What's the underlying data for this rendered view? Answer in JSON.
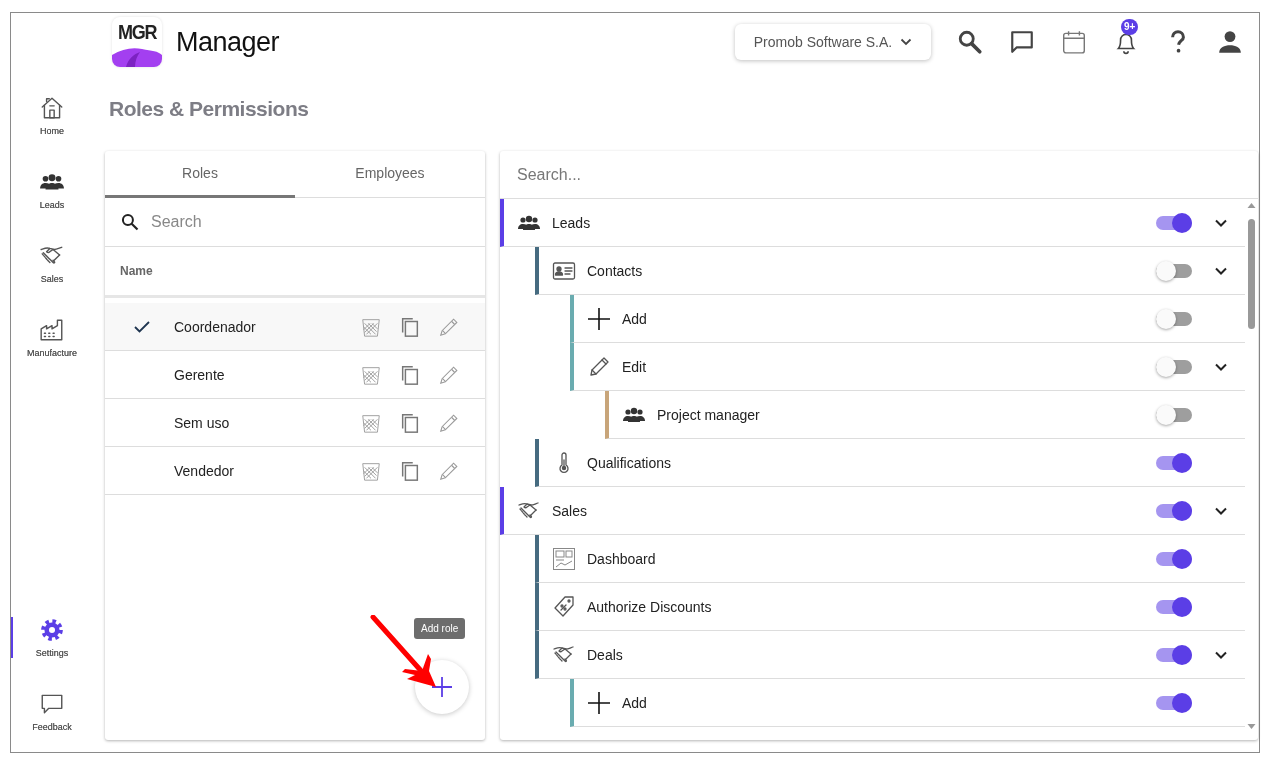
{
  "nav": {
    "top": [
      {
        "kind": "home",
        "label": "Home",
        "selected": false
      },
      {
        "kind": "leads",
        "label": "Leads",
        "selected": false
      },
      {
        "kind": "sales",
        "label": "Sales",
        "selected": false
      },
      {
        "kind": "manufacture",
        "label": "Manufacture",
        "selected": false
      }
    ],
    "bottom": [
      {
        "kind": "settings",
        "label": "Settings",
        "selected": true
      },
      {
        "kind": "feedback",
        "label": "Feedback",
        "selected": false
      }
    ]
  },
  "header": {
    "logo": "MGR",
    "app_name": "Manager",
    "company": "Promob Software S.A.",
    "notifications_badge": "9+"
  },
  "page_title": "Roles & Permissions",
  "roles_panel": {
    "tabs": [
      {
        "label": "Roles",
        "selected": true
      },
      {
        "label": "Employees",
        "selected": false
      }
    ],
    "search": {
      "placeholder": "Search"
    },
    "column": "Name",
    "rows": [
      {
        "name": "Coordenador",
        "selected": true
      },
      {
        "name": "Gerente",
        "selected": false
      },
      {
        "name": "Sem uso",
        "selected": false
      },
      {
        "name": "Vendedor",
        "selected": false
      }
    ],
    "add_tooltip": "Add role"
  },
  "permissions": {
    "search": {
      "placeholder": "Search..."
    },
    "items": [
      {
        "kind": "people",
        "label": "Leads",
        "on": true,
        "expanded": true,
        "children": [
          {
            "kind": "contacts",
            "label": "Contacts",
            "on": false,
            "expanded": true,
            "children": [
              {
                "kind": "add",
                "label": "Add",
                "on": false
              },
              {
                "kind": "edit",
                "label": "Edit",
                "on": false,
                "expanded": true,
                "children": [
                  {
                    "kind": "people",
                    "label": "Project manager",
                    "on": false
                  }
                ]
              }
            ]
          },
          {
            "kind": "qualifications",
            "label": "Qualifications",
            "on": true
          }
        ]
      },
      {
        "kind": "handshake",
        "label": "Sales",
        "on": true,
        "expanded": true,
        "children": [
          {
            "kind": "dashboard",
            "label": "Dashboard",
            "on": true
          },
          {
            "kind": "discounts",
            "label": "Authorize Discounts",
            "on": true
          },
          {
            "kind": "handshake",
            "label": "Deals",
            "on": true,
            "expanded": true,
            "children": [
              {
                "kind": "add",
                "label": "Add",
                "on": true
              }
            ]
          }
        ]
      }
    ]
  }
}
